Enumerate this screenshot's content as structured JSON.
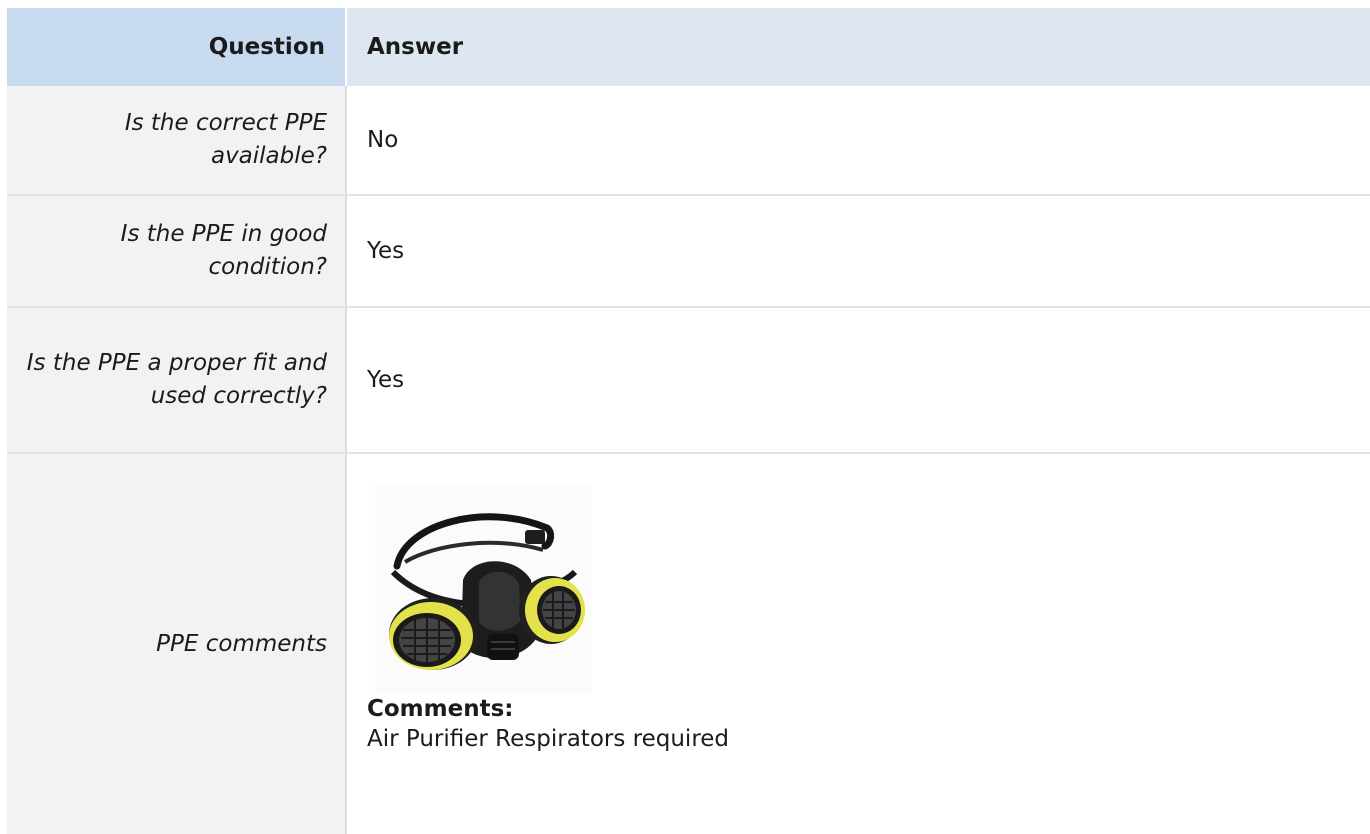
{
  "table": {
    "headers": {
      "question": "Question",
      "answer": "Answer"
    },
    "rows": [
      {
        "question": "Is the correct PPE available?",
        "answer": "No"
      },
      {
        "question": "Is the PPE in good condition?",
        "answer": "Yes"
      },
      {
        "question": "Is the PPE a proper fit and used correctly?",
        "answer": "Yes"
      },
      {
        "question": "PPE comments"
      }
    ]
  },
  "comments": {
    "label": "Comments:",
    "text": "Air Purifier Respirators required"
  },
  "colors": {
    "header_question_bg": "#c7daf0",
    "header_answer_bg": "#dde6f1",
    "question_cell_bg": "#f2f2f2",
    "mask_yellow": "#e4e24a"
  }
}
